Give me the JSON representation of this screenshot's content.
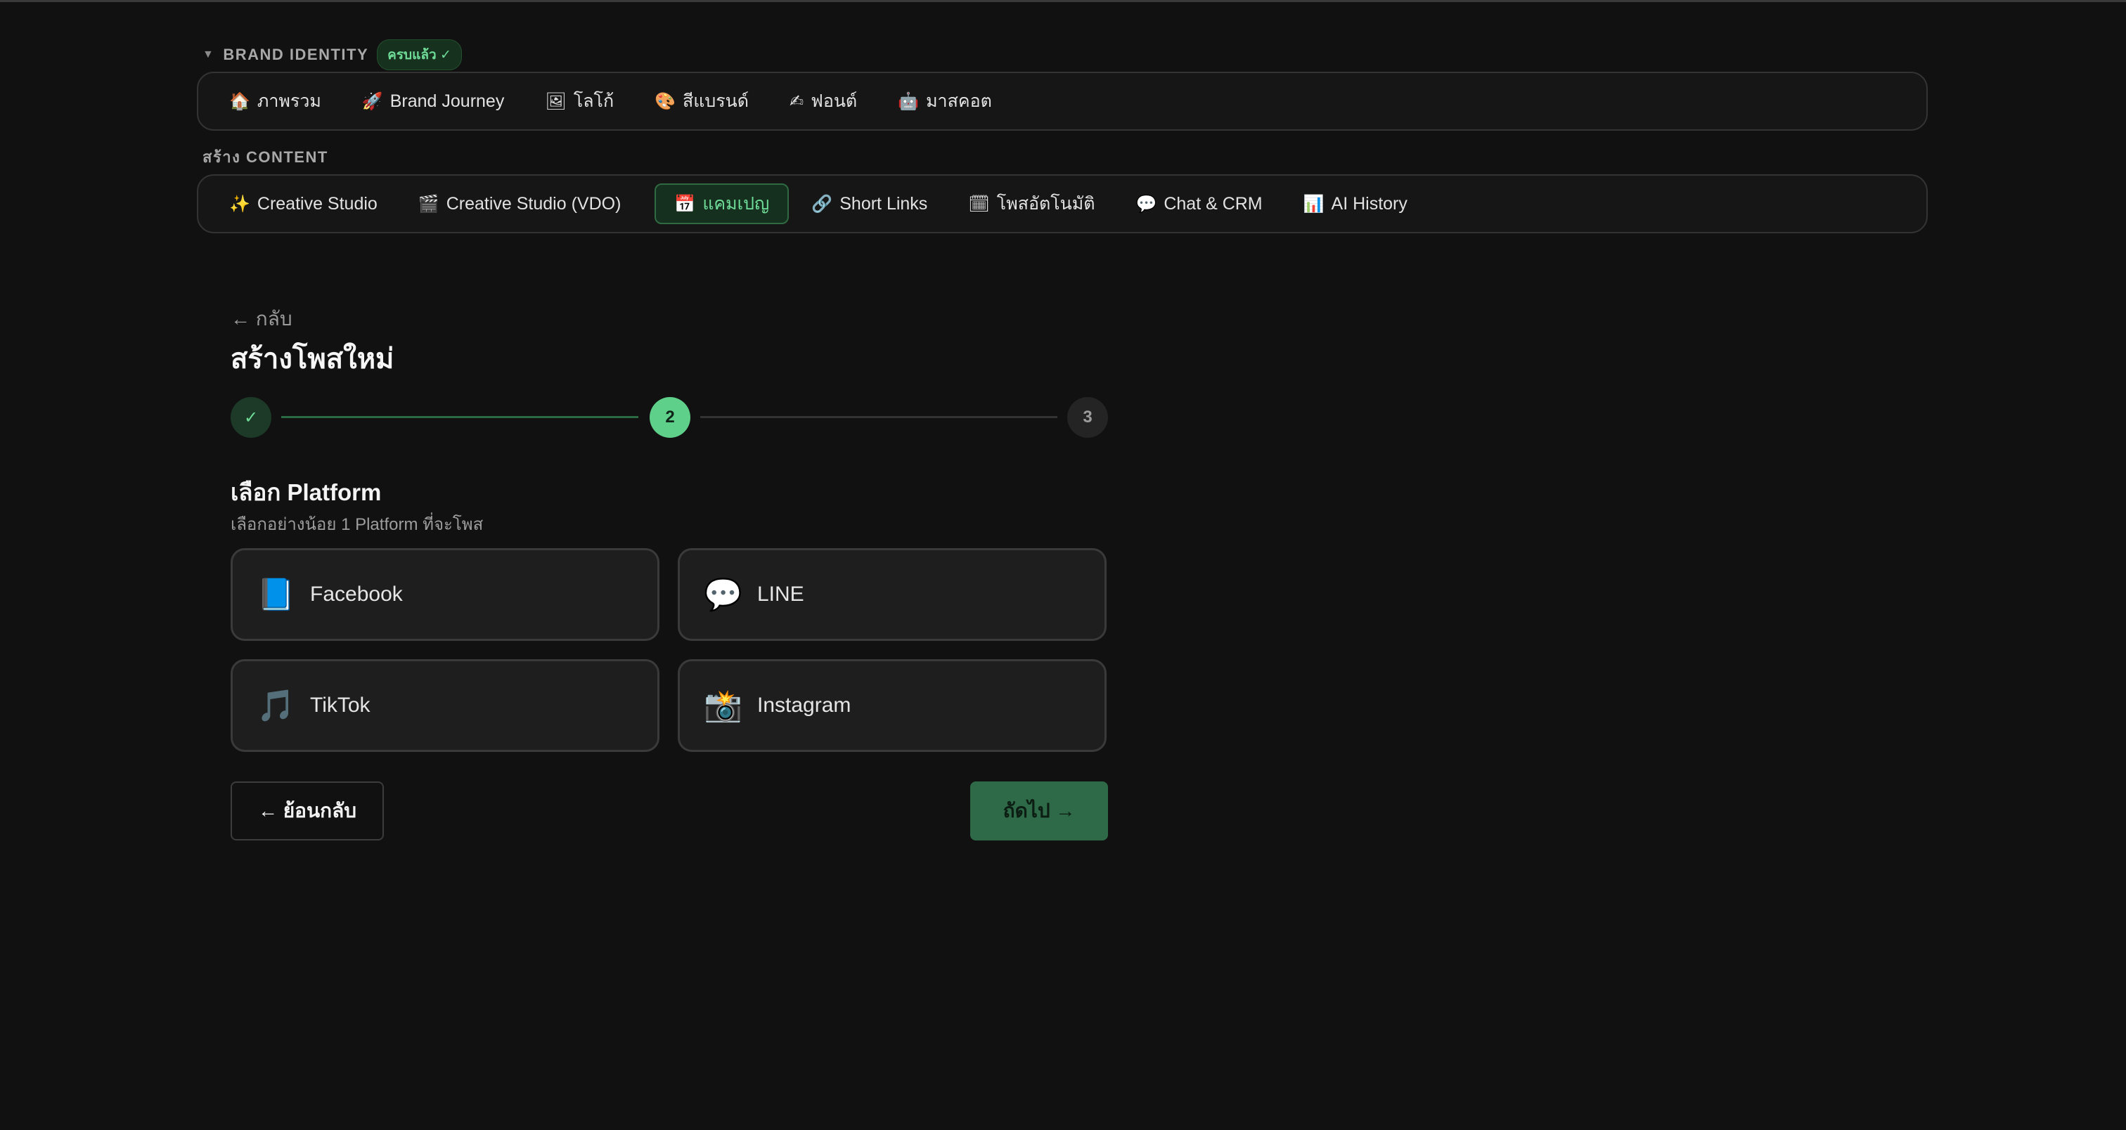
{
  "brand_section": {
    "label": "BRAND IDENTITY",
    "caret": "▼",
    "badge": "ครบแล้ว ✓",
    "items": [
      {
        "icon": "🏠",
        "label": "ภาพรวม"
      },
      {
        "icon": "🚀",
        "label": "Brand Journey"
      },
      {
        "icon": "🖼",
        "label": "โลโก้"
      },
      {
        "icon": "🎨",
        "label": "สีแบรนด์"
      },
      {
        "icon": "✍",
        "label": "ฟอนต์"
      },
      {
        "icon": "🤖",
        "label": "มาสคอต"
      }
    ]
  },
  "content_section": {
    "label": "สร้าง CONTENT",
    "items": [
      {
        "icon": "✨",
        "label": "Creative Studio"
      },
      {
        "icon": "🎬",
        "label": "Creative Studio (VDO)"
      },
      {
        "icon": "📅",
        "label": "แคมเปญ",
        "active": true
      },
      {
        "icon": "🔗",
        "label": "Short Links"
      },
      {
        "icon": "🗓",
        "label": "โพสอัตโนมัติ"
      },
      {
        "icon": "💬",
        "label": "Chat & CRM"
      },
      {
        "icon": "📊",
        "label": "AI History"
      }
    ]
  },
  "page": {
    "back_link": "← กลับ",
    "title": "สร้างโพสใหม่"
  },
  "stepper": {
    "step1": "✓",
    "step2": "2",
    "step3": "3",
    "current_step": 2,
    "total_steps": 3
  },
  "platform_step": {
    "title": "เลือก Platform",
    "subtitle": "เลือกอย่างน้อย 1 Platform ที่จะโพส",
    "options": [
      {
        "icon": "📘",
        "label": "Facebook"
      },
      {
        "icon": "💬",
        "label": "LINE"
      },
      {
        "icon": "🎵",
        "label": "TikTok"
      },
      {
        "icon": "📸",
        "label": "Instagram"
      }
    ]
  },
  "actions": {
    "back": "← ย้อนกลับ",
    "next": "ถัดไป →"
  },
  "colors": {
    "background": "#111111",
    "accent": "#5fd08a",
    "accent_dark": "#2e6a47"
  }
}
